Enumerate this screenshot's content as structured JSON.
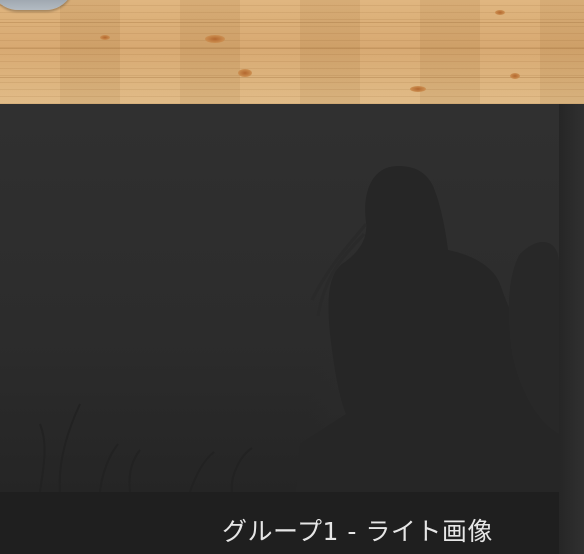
{
  "caption": {
    "text": "グループ1 - ライト画像"
  },
  "colors": {
    "wood": "#d6a66c",
    "photo_background": "#2c2c2c",
    "caption_bar": "#1f1f1f",
    "caption_text": "#e6e6e6"
  },
  "images": {
    "top": "wood-texture-image",
    "main": "silhouette-photo-image"
  }
}
